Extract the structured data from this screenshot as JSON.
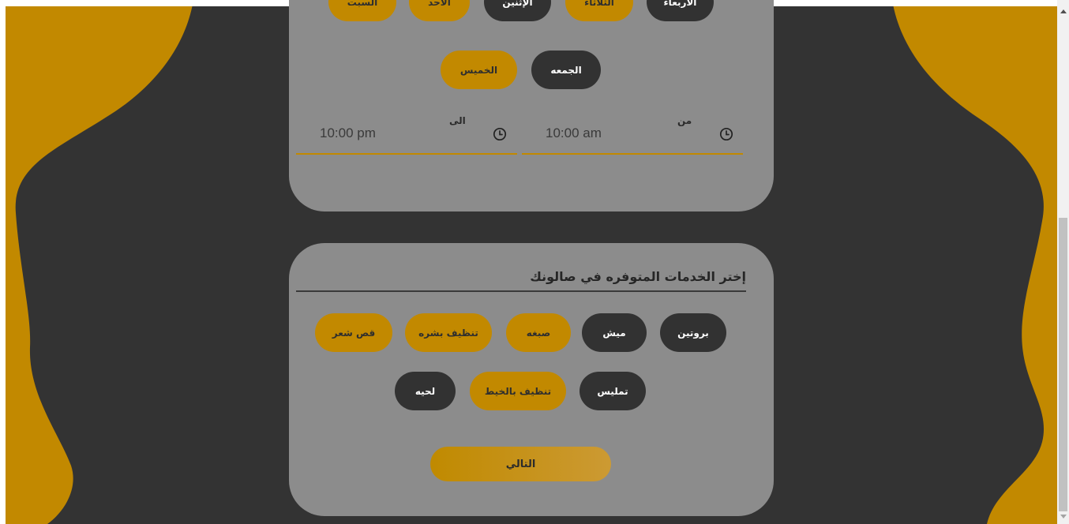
{
  "colors": {
    "background": "#333333",
    "accent_gold": "#c28900",
    "card_gray": "#8c8c8c",
    "pill_dark": "#323232"
  },
  "schedule": {
    "days_row1": [
      {
        "label": "الاربعاء",
        "selected": false
      },
      {
        "label": "الثلاثاء",
        "selected": true
      },
      {
        "label": "الإثنين",
        "selected": false
      },
      {
        "label": "الاحد",
        "selected": true
      },
      {
        "label": "السبت",
        "selected": true
      }
    ],
    "days_row2": [
      {
        "label": "الجمعه",
        "selected": false
      },
      {
        "label": "الخميس",
        "selected": true
      }
    ],
    "from": {
      "label": "من",
      "value": "10:00 am",
      "icon": "clock-icon"
    },
    "to": {
      "label": "الى",
      "value": "10:00 pm",
      "icon": "clock-icon"
    }
  },
  "services": {
    "title": "إختر الخدمات المتوفره في صالونك",
    "items_row1": [
      {
        "label": "بروتين",
        "selected": false
      },
      {
        "label": "ميش",
        "selected": false
      },
      {
        "label": "صبغه",
        "selected": true
      },
      {
        "label": "تنظيف بشره",
        "selected": true
      },
      {
        "label": "قص شعر",
        "selected": true
      }
    ],
    "items_row2": [
      {
        "label": "تمليس",
        "selected": false
      },
      {
        "label": "تنظيف بالخيط",
        "selected": true
      },
      {
        "label": "لحيه",
        "selected": false
      }
    ],
    "next_label": "التالي"
  }
}
